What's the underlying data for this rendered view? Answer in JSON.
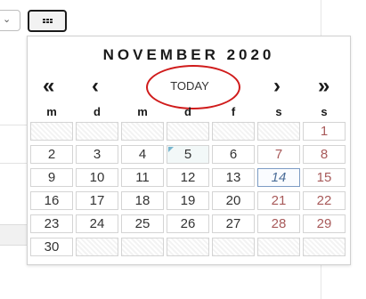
{
  "calendar": {
    "month_title": "NOVEMBER 2020",
    "nav": {
      "prev_year": "«",
      "prev_month": "‹",
      "next_month": "›",
      "next_year": "»"
    },
    "today_label": "TODAY",
    "weekdays": [
      "m",
      "d",
      "m",
      "d",
      "f",
      "s",
      "s"
    ],
    "weeks": [
      [
        "",
        "",
        "",
        "",
        "",
        "",
        "1"
      ],
      [
        "2",
        "3",
        "4",
        "5",
        "6",
        "7",
        "8"
      ],
      [
        "9",
        "10",
        "11",
        "12",
        "13",
        "14",
        "15"
      ],
      [
        "16",
        "17",
        "18",
        "19",
        "20",
        "21",
        "22"
      ],
      [
        "23",
        "24",
        "25",
        "26",
        "27",
        "28",
        "29"
      ],
      [
        "30",
        "",
        "",
        "",
        "",
        "",
        ""
      ]
    ],
    "today": "14",
    "marked_day": "5",
    "colors": {
      "weekend": "#a85a5a",
      "today_border": "#7d9cc4",
      "highlight_ring": "#d01b1b"
    }
  }
}
